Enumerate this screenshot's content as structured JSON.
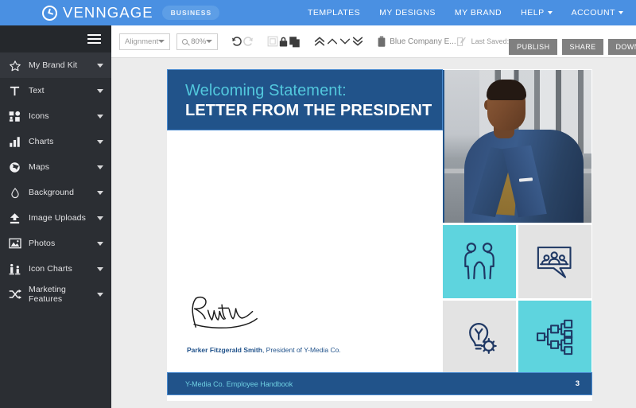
{
  "topbar": {
    "brand_name": "VENNGAGE",
    "brand_badge": "BUSINESS",
    "nav": [
      {
        "label": "TEMPLATES",
        "caret": false
      },
      {
        "label": "MY DESIGNS",
        "caret": false
      },
      {
        "label": "MY BRAND",
        "caret": false
      },
      {
        "label": "HELP",
        "caret": true
      },
      {
        "label": "ACCOUNT",
        "caret": true
      }
    ],
    "background_color": "#4a90e2"
  },
  "sidebar": {
    "background_color": "#2b2e33",
    "items": [
      {
        "label": "My Brand Kit",
        "icon": "star-icon",
        "active": true
      },
      {
        "label": "Text",
        "icon": "text-icon",
        "active": false
      },
      {
        "label": "Icons",
        "icon": "icons-icon",
        "active": false
      },
      {
        "label": "Charts",
        "icon": "bar-chart-icon",
        "active": false
      },
      {
        "label": "Maps",
        "icon": "globe-icon",
        "active": false
      },
      {
        "label": "Background",
        "icon": "droplet-icon",
        "active": false
      },
      {
        "label": "Image Uploads",
        "icon": "upload-icon",
        "active": false
      },
      {
        "label": "Photos",
        "icon": "photo-icon",
        "active": false
      },
      {
        "label": "Icon Charts",
        "icon": "icon-chart-icon",
        "active": false
      },
      {
        "label": "Marketing Features",
        "icon": "shuffle-icon",
        "active": false
      }
    ]
  },
  "toolbar": {
    "alignment_placeholder": "Alignment",
    "zoom_value": "80%",
    "document_title": "Blue Company E...",
    "last_saved_label": "Last Saved:",
    "publish_label": "PUBLISH",
    "share_label": "SHARE",
    "download_label": "DOWNLOAD",
    "tools": [
      "undo-icon",
      "redo-icon",
      "group-icon",
      "lock-icon",
      "duplicate-icon",
      "bring-to-front-icon",
      "bring-forward-icon",
      "send-backward-icon",
      "send-to-back-icon",
      "delete-icon",
      "edit-title-icon"
    ]
  },
  "canvas": {
    "header": {
      "line1": "Welcoming Statement:",
      "line2": "LETTER FROM THE PRESIDENT",
      "background_color": "#21538a",
      "line1_color": "#52c8dd"
    },
    "signature": {
      "author_name": "Parker Fitzgerald Smith",
      "author_title": ", President of Y-Media Co."
    },
    "tiles": [
      {
        "icon": "handshake-icon",
        "background_color": "#5ed4de"
      },
      {
        "icon": "group-speech-bubble-icon",
        "background_color": "#e3e3e3"
      },
      {
        "icon": "lightbulb-gear-icon",
        "background_color": "#e3e3e3"
      },
      {
        "icon": "org-chart-icon",
        "background_color": "#5ed4de"
      }
    ],
    "footer": {
      "text": "Y-Media Co. Employee Handbook",
      "page_number": "3",
      "background_color": "#21538a"
    },
    "photo_alt": "portrait-photo"
  }
}
